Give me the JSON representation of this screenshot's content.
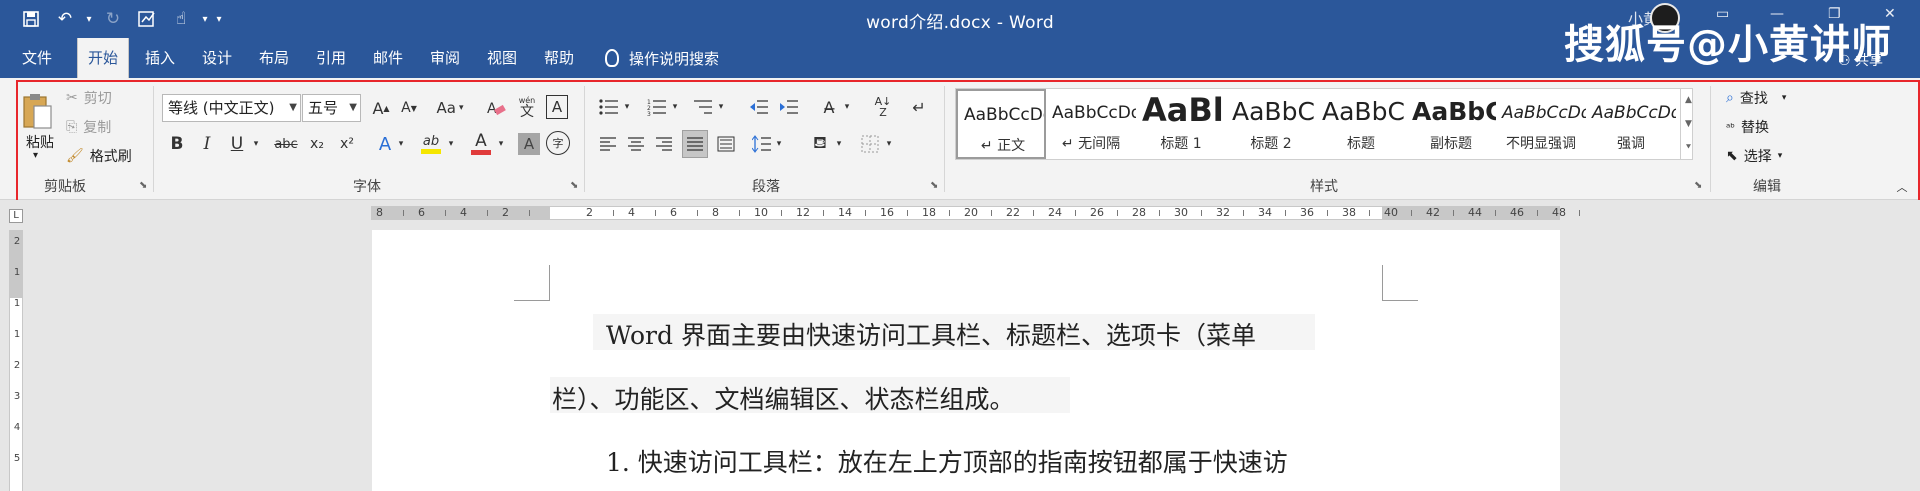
{
  "window": {
    "title": "word介绍.docx - Word",
    "user_name": "小黄",
    "watermark": "搜狐号@小黄讲师",
    "share_label": "共享"
  },
  "quick_access": {
    "icons": [
      "save-icon",
      "undo-icon",
      "redo-icon",
      "form-icon",
      "touch-mode-icon",
      "customize-icon"
    ]
  },
  "tabs": [
    "文件",
    "开始",
    "插入",
    "设计",
    "布局",
    "引用",
    "邮件",
    "审阅",
    "视图",
    "帮助"
  ],
  "active_tab": "开始",
  "tell_me": "操作说明搜索",
  "clipboard": {
    "paste": "粘贴",
    "cut": "剪切",
    "copy": "复制",
    "format_painter": "格式刷",
    "label": "剪贴板"
  },
  "font": {
    "font_name": "等线 (中文正文)",
    "font_size": "五号",
    "label": "字体",
    "grow": "A",
    "shrink": "A",
    "change_case": "Aa",
    "pinyin_top": "wén",
    "pinyin_char": "文",
    "border_char": "A",
    "bold": "B",
    "italic": "I",
    "underline": "U",
    "strike": "abc",
    "subscript": "x₂",
    "superscript": "x²",
    "effects": "A",
    "highlight": "ab",
    "color": "A",
    "shading": "A",
    "enclose": "字",
    "highlight_color": "#f5e600",
    "font_color": "#e03b3b"
  },
  "paragraph": {
    "label": "段落"
  },
  "styles": {
    "label": "样式",
    "items": [
      {
        "sample": "AaBbCcDd",
        "name": "↵ 正文",
        "size": 17,
        "weight": "normal"
      },
      {
        "sample": "AaBbCcDd",
        "name": "↵ 无间隔",
        "size": 17,
        "weight": "normal"
      },
      {
        "sample": "AaBl",
        "name": "标题 1",
        "size": 32,
        "weight": "bold"
      },
      {
        "sample": "AaBbC",
        "name": "标题 2",
        "size": 25,
        "weight": "normal"
      },
      {
        "sample": "AaBbC",
        "name": "标题",
        "size": 25,
        "weight": "normal"
      },
      {
        "sample": "AaBbC",
        "name": "副标题",
        "size": 25,
        "weight": "bold"
      },
      {
        "sample": "AaBbCcDd",
        "name": "不明显强调",
        "size": 17,
        "weight": "normal"
      },
      {
        "sample": "AaBbCcDd",
        "name": "强调",
        "size": 17,
        "weight": "normal"
      }
    ]
  },
  "editing": {
    "label": "编辑",
    "find": "查找",
    "replace": "替换",
    "select": "选择"
  },
  "ruler": {
    "numbers": [
      "8",
      "6",
      "4",
      "2",
      "2",
      "4",
      "6",
      "8",
      "10",
      "12",
      "14",
      "16",
      "18",
      "20",
      "22",
      "24",
      "26",
      "28",
      "30",
      "32",
      "34",
      "36",
      "38",
      "40",
      "42",
      "44",
      "46",
      "48"
    ],
    "tab_selector": "L"
  },
  "vruler": {
    "numbers": [
      "2",
      "1",
      "1",
      "1",
      "2",
      "3",
      "4",
      "5"
    ]
  },
  "document": {
    "lines": [
      "Word 界面主要由快速访问工具栏、标题栏、选项卡（菜单",
      "栏）、功能区、文档编辑区、状态栏组成。",
      "1. 快速访问工具栏：放在左上方顶部的指南按钮都属于快速访"
    ]
  }
}
